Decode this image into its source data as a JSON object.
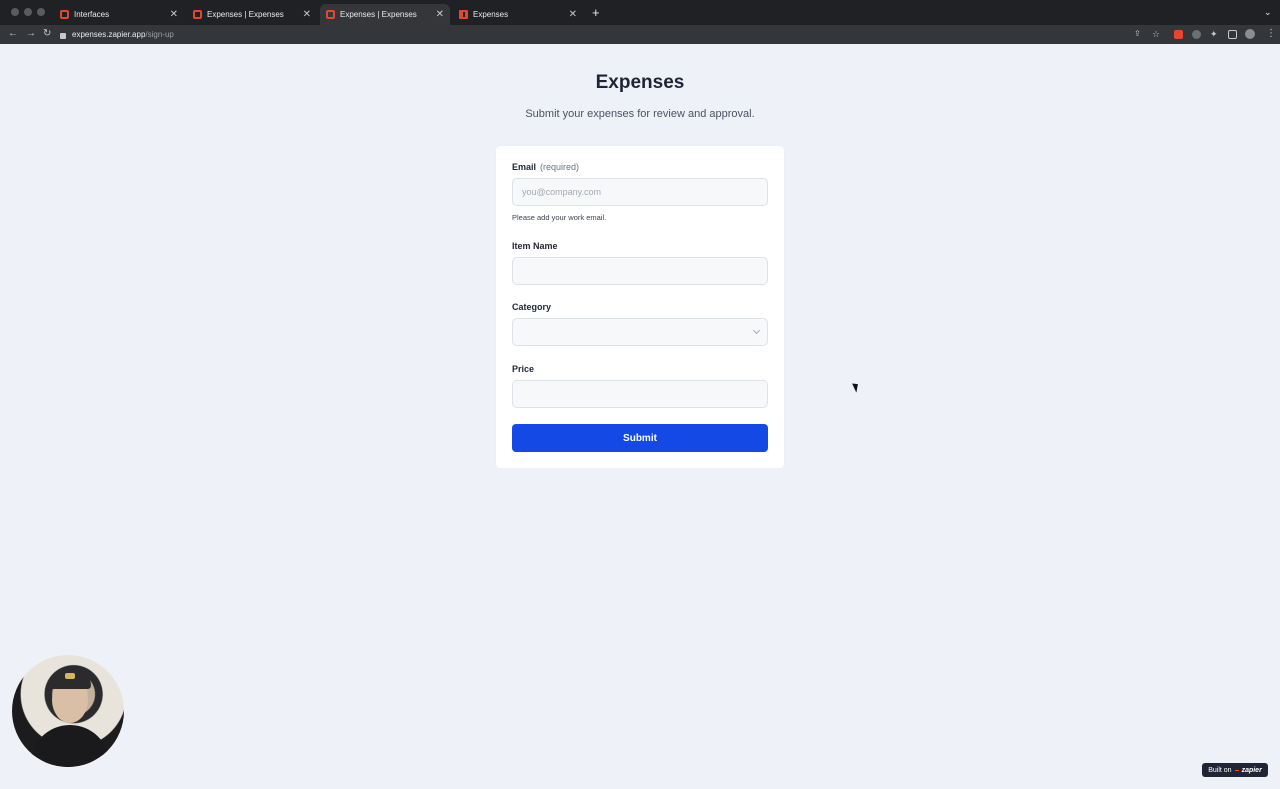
{
  "browser": {
    "tabs": [
      {
        "label": "Interfaces",
        "active": false,
        "icon": "zapier-interfaces-icon"
      },
      {
        "label": "Expenses | Expenses",
        "active": false,
        "icon": "zapier-interfaces-icon"
      },
      {
        "label": "Expenses | Expenses",
        "active": true,
        "icon": "zapier-interfaces-icon"
      },
      {
        "label": "Expenses",
        "active": false,
        "icon": "zapier-tables-icon"
      }
    ],
    "url_host": "expenses.zapier.app",
    "url_path": "/sign-up"
  },
  "page": {
    "title": "Expenses",
    "subtitle": "Submit your expenses for review and approval."
  },
  "form": {
    "email": {
      "label": "Email",
      "required_text": "(required)",
      "placeholder": "you@company.com",
      "value": "",
      "hint": "Please add your work email."
    },
    "item_name": {
      "label": "Item Name",
      "value": ""
    },
    "category": {
      "label": "Category",
      "selected": ""
    },
    "price": {
      "label": "Price",
      "value": ""
    },
    "submit_label": "Submit"
  },
  "footer": {
    "built_on": "Built on",
    "brand": "zapier"
  },
  "colors": {
    "accent": "#1449e6",
    "page_bg": "#eef1f7",
    "chrome_bg": "#202124"
  }
}
